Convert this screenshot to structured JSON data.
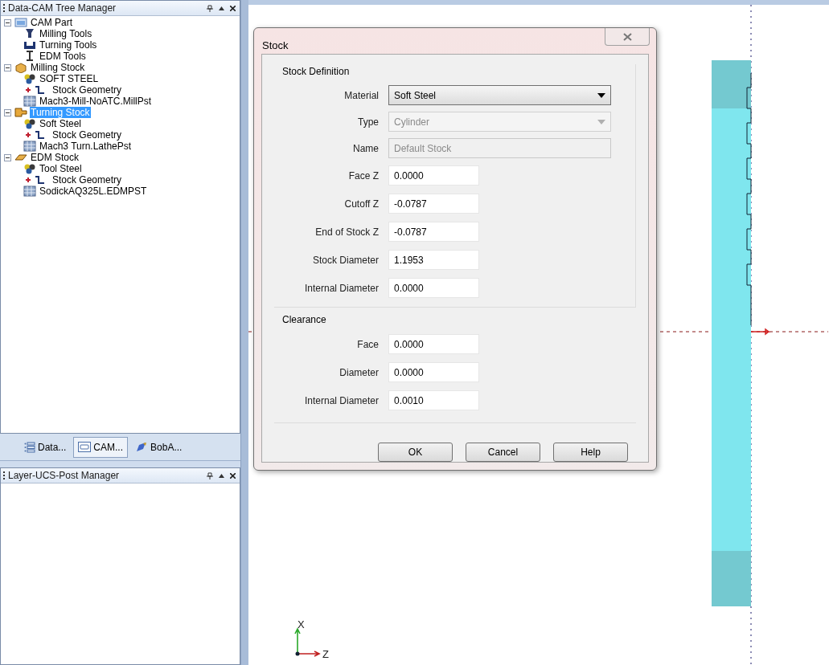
{
  "tree_panel": {
    "title": "Data-CAM Tree Manager",
    "items": [
      {
        "label": "CAM Part",
        "kind": "part",
        "expanded": true,
        "selected": false,
        "children": [
          {
            "label": "Milling Tools",
            "kind": "mill-tool",
            "selected": false
          },
          {
            "label": "Turning Tools",
            "kind": "turn-tool",
            "selected": false
          },
          {
            "label": "EDM Tools",
            "kind": "edm-tool",
            "selected": false
          }
        ]
      },
      {
        "label": "Milling Stock",
        "kind": "mill-stock",
        "expanded": true,
        "selected": false,
        "children": [
          {
            "label": "SOFT STEEL",
            "kind": "material",
            "selected": false
          },
          {
            "label": "Stock Geometry",
            "kind": "geometry",
            "selected": false
          },
          {
            "label": "Mach3-Mill-NoATC.MillPst",
            "kind": "post",
            "selected": false
          }
        ]
      },
      {
        "label": "Turning Stock",
        "kind": "turn-stock",
        "expanded": true,
        "selected": true,
        "children": [
          {
            "label": "Soft Steel",
            "kind": "material",
            "selected": false
          },
          {
            "label": "Stock Geometry",
            "kind": "geometry",
            "selected": false
          },
          {
            "label": "Mach3 Turn.LathePst",
            "kind": "post",
            "selected": false
          }
        ]
      },
      {
        "label": "EDM Stock",
        "kind": "edm-stock",
        "expanded": true,
        "selected": false,
        "children": [
          {
            "label": "Tool Steel",
            "kind": "material",
            "selected": false
          },
          {
            "label": "Stock Geometry",
            "kind": "geometry",
            "selected": false
          },
          {
            "label": "SodickAQ325L.EDMPST",
            "kind": "post",
            "selected": false
          }
        ]
      }
    ],
    "tabs": [
      {
        "label": "Data...",
        "kind": "data",
        "selected": false
      },
      {
        "label": "CAM...",
        "kind": "cam",
        "selected": true
      },
      {
        "label": "BobA...",
        "kind": "bob",
        "selected": false
      }
    ]
  },
  "layer_panel": {
    "title": "Layer-UCS-Post Manager"
  },
  "dialog": {
    "title": "Stock",
    "groups": [
      {
        "title": "Stock Definition",
        "fields": [
          {
            "label": "Material",
            "kind": "select",
            "value": "Soft Steel",
            "disabled": false
          },
          {
            "label": "Type",
            "kind": "select",
            "value": "Cylinder",
            "disabled": true
          },
          {
            "label": "Name",
            "kind": "text",
            "value": "Default Stock",
            "disabled": true
          },
          {
            "label": "Face Z",
            "kind": "number",
            "value": "0.0000",
            "disabled": false
          },
          {
            "label": "Cutoff Z",
            "kind": "number",
            "value": "-0.0787",
            "disabled": false
          },
          {
            "label": "End of Stock Z",
            "kind": "number",
            "value": "-0.0787",
            "disabled": false
          },
          {
            "label": "Stock Diameter",
            "kind": "number",
            "value": "1.1953",
            "disabled": false
          },
          {
            "label": "Internal Diameter",
            "kind": "number",
            "value": "0.0000",
            "disabled": false
          }
        ]
      },
      {
        "title": "Clearance",
        "fields": [
          {
            "label": "Face",
            "kind": "number",
            "value": "0.0000",
            "disabled": false
          },
          {
            "label": "Diameter",
            "kind": "number",
            "value": "0.0000",
            "disabled": false
          },
          {
            "label": "Internal Diameter",
            "kind": "number",
            "value": "0.0010",
            "disabled": false
          }
        ]
      }
    ],
    "buttons": [
      "OK",
      "Cancel",
      "Help"
    ]
  },
  "viewport": {
    "axis_labels": [
      "X",
      "Z"
    ]
  }
}
